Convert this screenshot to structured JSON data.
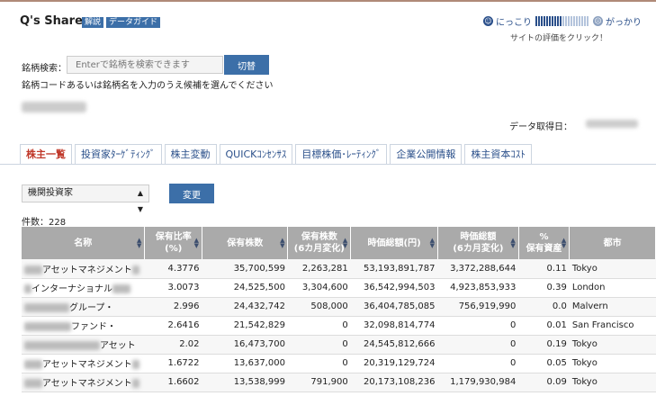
{
  "header": {
    "brand": "Q's Share",
    "tag_explain": "解説",
    "tag_guide": "データガイド"
  },
  "rating": {
    "positive": "にっこり",
    "negative": "がっかり",
    "positive_icon": "smile-icon",
    "negative_icon": "frown-icon",
    "note": "サイトの評価をクリック！"
  },
  "search": {
    "label": "銘柄検索：",
    "placeholder": "Enterで銘柄を検索できます",
    "button": "切替",
    "help": "銘柄コードあるいは銘柄名を入力のうえ候補を選んでください"
  },
  "data_date_label": "データ取得日：",
  "tabs": [
    "株主一覧",
    "投資家ﾀｰｹﾞﾃｨﾝｸﾞ",
    "株主変動",
    "QUICKｺﾝｾﾝｻｽ",
    "目標株価･ﾚｰﾃｨﾝｸﾞ",
    "企業公開情報",
    "株主資本ｺｽﾄ"
  ],
  "filter": {
    "selected": "機関投資家",
    "button": "変更"
  },
  "count_text": "件数：228",
  "table": {
    "headers": [
      "名称",
      "保有比率\n(%)",
      "保有株数",
      "保有株数\n(6カ月変化)",
      "時価総額(円)",
      "時価総額\n(6カ月変化)",
      "%\n保有資産",
      "都市"
    ],
    "rows": [
      {
        "name": "アセットマネジメント",
        "ratio": "4.3776",
        "shares": "35,700,599",
        "shares_chg": "2,263,281",
        "mcap": "53,193,891,787",
        "mcap_chg": "3,372,288,644",
        "pct": "0.11",
        "city": "Tokyo"
      },
      {
        "name": "インターナショナル",
        "ratio": "3.0073",
        "shares": "24,525,500",
        "shares_chg": "3,304,600",
        "mcap": "36,542,994,503",
        "mcap_chg": "4,923,853,933",
        "pct": "0.39",
        "city": "London"
      },
      {
        "name": "グループ・",
        "ratio": "2.996",
        "shares": "24,432,742",
        "shares_chg": "508,000",
        "mcap": "36,404,785,085",
        "mcap_chg": "756,919,990",
        "pct": "0.0",
        "city": "Malvern"
      },
      {
        "name": "ファンド・",
        "ratio": "2.6416",
        "shares": "21,542,829",
        "shares_chg": "0",
        "mcap": "32,098,814,774",
        "mcap_chg": "0",
        "pct": "0.01",
        "city": "San Francisco"
      },
      {
        "name": "アセット",
        "ratio": "2.02",
        "shares": "16,473,700",
        "shares_chg": "0",
        "mcap": "24,545,812,666",
        "mcap_chg": "0",
        "pct": "0.19",
        "city": "Tokyo"
      },
      {
        "name": "アセットマネジメント",
        "ratio": "1.6722",
        "shares": "13,637,000",
        "shares_chg": "0",
        "mcap": "20,319,129,724",
        "mcap_chg": "0",
        "pct": "0.05",
        "city": "Tokyo"
      },
      {
        "name": "アセットマネジメント",
        "ratio": "1.6602",
        "shares": "13,538,999",
        "shares_chg": "791,900",
        "mcap": "20,173,108,236",
        "mcap_chg": "1,179,930,984",
        "pct": "0.09",
        "city": "Tokyo"
      }
    ]
  }
}
